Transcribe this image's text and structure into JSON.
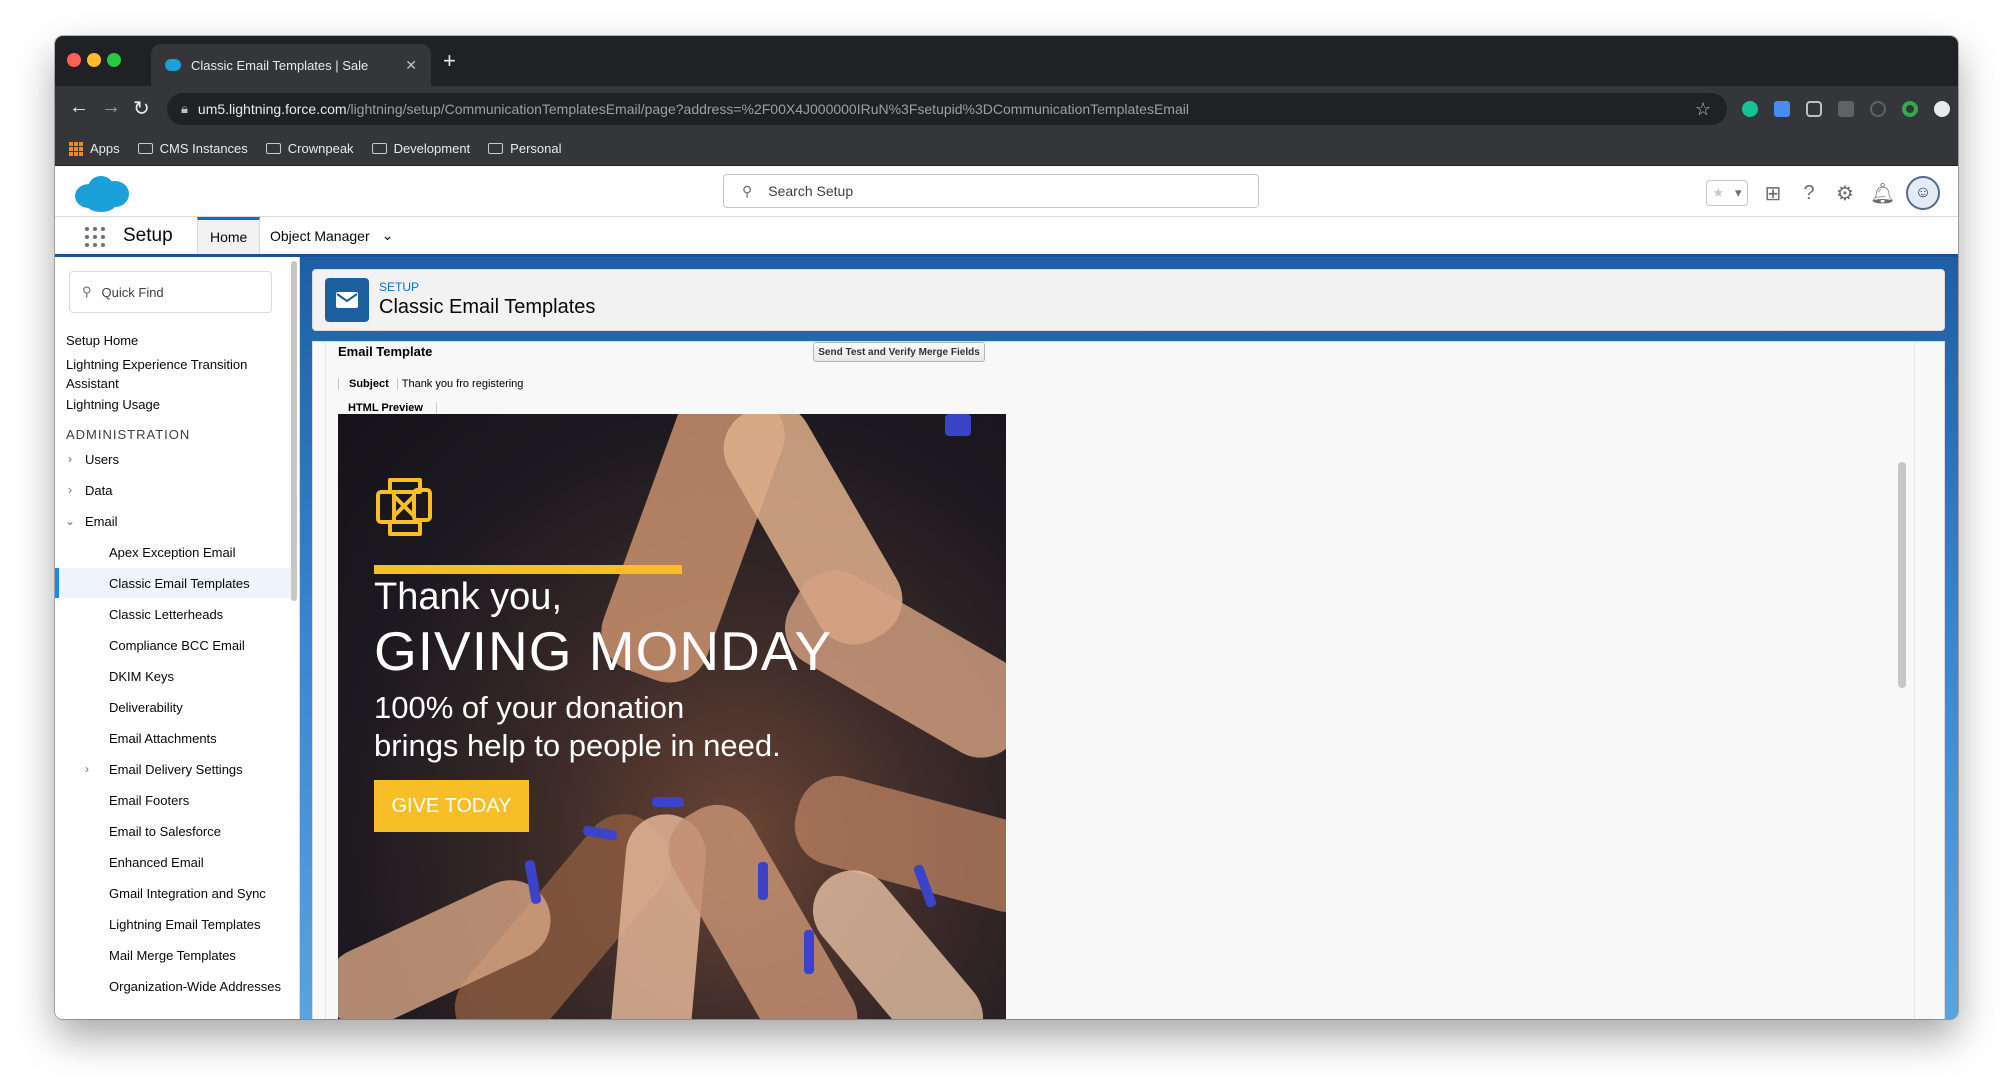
{
  "browser": {
    "tab_title": "Classic Email Templates | Sale",
    "url_host": "um5.lightning.force.com",
    "url_path": "/lightning/setup/CommunicationTemplatesEmail/page?address=%2F00X4J000000IRuN%3Fsetupid%3DCommunicationTemplatesEmail",
    "bookmarks": [
      "Apps",
      "CMS Instances",
      "Crownpeak",
      "Development",
      "Personal"
    ]
  },
  "header": {
    "search_placeholder": "Search Setup"
  },
  "nav": {
    "app_name": "Setup",
    "tabs": [
      "Home",
      "Object Manager"
    ]
  },
  "sidebar": {
    "quick_find_placeholder": "Quick Find",
    "links": [
      "Setup Home",
      "Lightning Experience Transition Assistant",
      "Lightning Usage"
    ],
    "section_heading": "ADMINISTRATION",
    "top_items": [
      "Users",
      "Data",
      "Email"
    ],
    "email_items": [
      "Apex Exception Email",
      "Classic Email Templates",
      "Classic Letterheads",
      "Compliance BCC Email",
      "DKIM Keys",
      "Deliverability",
      "Email Attachments",
      "Email Delivery Settings",
      "Email Footers",
      "Email to Salesforce",
      "Enhanced Email",
      "Gmail Integration and Sync",
      "Lightning Email Templates",
      "Mail Merge Templates",
      "Organization-Wide Addresses"
    ],
    "selected_item": "Classic Email Templates"
  },
  "page_header": {
    "eyebrow": "SETUP",
    "title": "Classic Email Templates"
  },
  "template": {
    "section_title": "Email Template",
    "send_button": "Send Test and Verify Merge Fields",
    "subject_label": "Subject",
    "subject_value": "Thank you fro registering",
    "preview_label": "HTML Preview"
  },
  "email_preview": {
    "line1": "Thank you,",
    "line2": "GIVING MONDAY",
    "line3": "100% of your donation",
    "line4": "brings help to people in need.",
    "cta": "GIVE TODAY",
    "accent_color": "#f7be28"
  }
}
